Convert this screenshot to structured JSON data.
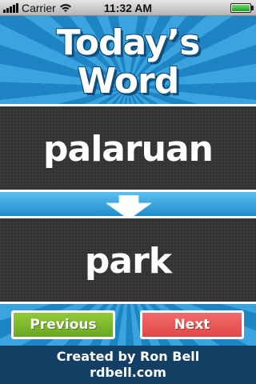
{
  "status_bar": {
    "carrier": "Carrier",
    "time": "11:32 AM",
    "signal_bars": 5,
    "battery_level": 1.0
  },
  "header": {
    "title_line1": "Today’s",
    "title_line2": "Word"
  },
  "word": {
    "source": "palaruan",
    "translation": "park"
  },
  "buttons": {
    "previous_label": "Previous",
    "next_label": "Next"
  },
  "footer": {
    "credit": "Created by Ron Bell",
    "website": "rdbell.com"
  },
  "colors": {
    "sky_light": "#3aa4df",
    "sky_dark": "#1e84c4",
    "panel": "#333333",
    "previous_button": "#7cb82f",
    "next_button": "#ea5a5a",
    "footer": "#123f63"
  },
  "icons": [
    "signal-bars-icon",
    "wifi-icon",
    "battery-icon",
    "down-arrow-icon"
  ]
}
